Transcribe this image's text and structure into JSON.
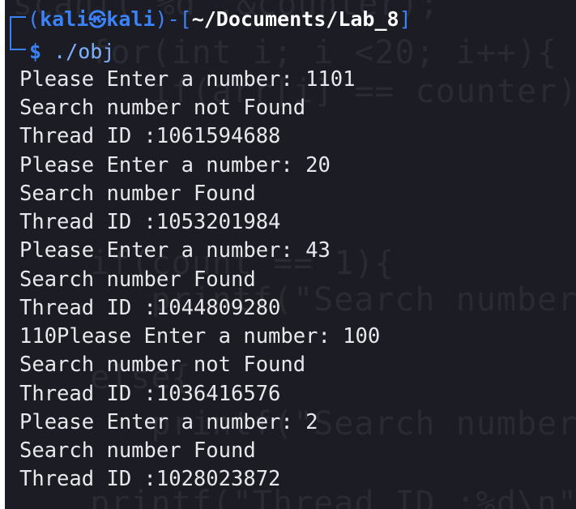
{
  "prompt": {
    "open": "(",
    "user": "kali",
    "at_symbol": "㉿",
    "host": "kali",
    "close": ")",
    "dash": "-",
    "path_open": "[",
    "path": "~/Documents/Lab_8",
    "path_close": "]",
    "dollar": "$",
    "command": "./obj"
  },
  "output": [
    "Please Enter a number: 1101",
    "Search number not Found",
    "Thread ID :1061594688",
    "Please Enter a number: 20",
    "Search number Found",
    "Thread ID :1053201984",
    "Please Enter a number: 43",
    "Search number Found",
    "Thread ID :1044809280",
    "110Please Enter a number: 100",
    "Search number not Found",
    "Thread ID :1036416576",
    "Please Enter a number: 2",
    "Search number Found",
    "Thread ID :1028023872"
  ],
  "background_code": [
    "scanf(\"%d\",&counter);",
    "   for(int i; i <20; i++){",
    "      if(arr[i] == counter){",
    "",
    "",
    "",
    "",
    "",
    "   if(count == 1){",
    "      printf(\"Search number Found",
    "",
    "   else{",
    "      printf(\"Search number not F",
    "",
    "",
    "   printf(\"Thread ID :%d\\n\",pt"
  ],
  "colors": {
    "background": "#1c1c24",
    "prompt_blue": "#3b82f6",
    "text": "#e8e8ec",
    "ghost_text": "#2a2a32"
  }
}
